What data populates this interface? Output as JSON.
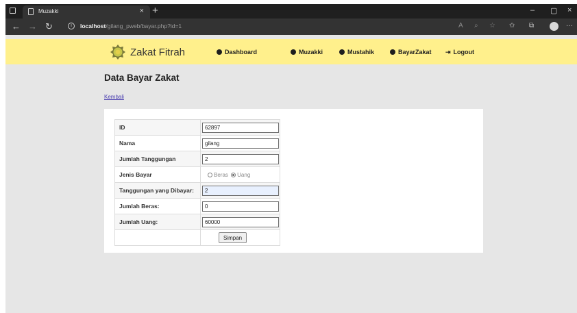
{
  "browser": {
    "tab_title": "Muzakki",
    "url_host": "localhost",
    "url_path": "/gilang_pweb/bayar.php?id=1",
    "tab_close": "×",
    "new_tab": "+",
    "controls": {
      "minimize": "–",
      "maximize": "▢",
      "close": "×"
    }
  },
  "navbar": {
    "brand": "Zakat Fitrah",
    "items": [
      {
        "label": "Dashboard",
        "icon": "user-circle-icon"
      },
      {
        "label": "Muzakki",
        "icon": "user-circle-icon"
      },
      {
        "label": "Mustahik",
        "icon": "user-circle-icon"
      },
      {
        "label": "BayarZakat",
        "icon": "user-circle-icon"
      },
      {
        "label": "Logout",
        "icon": "logout-icon"
      }
    ],
    "accent": "#fff08c"
  },
  "page": {
    "title": "Data Bayar Zakat",
    "back_link": "Kembali"
  },
  "form": {
    "id_label": "ID",
    "id_value": "62897",
    "nama_label": "Nama",
    "nama_value": "gilang",
    "tanggungan_label": "Jumlah Tanggungan",
    "tanggungan_value": "2",
    "jenis_label": "Jenis Bayar",
    "jenis_options": [
      "Beras",
      "Uang"
    ],
    "jenis_selected": "Uang",
    "dibayar_label": "Tanggungan yang Dibayar:",
    "dibayar_value": "2",
    "beras_label": "Jumlah Beras:",
    "beras_value": "0",
    "uang_label": "Jumlah Uang:",
    "uang_value": "60000",
    "submit_label": "Simpan"
  }
}
